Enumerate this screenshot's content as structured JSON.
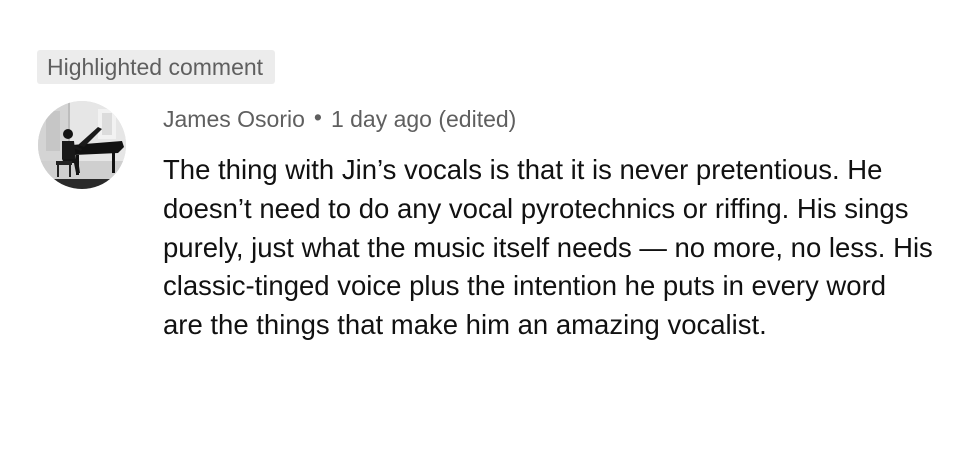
{
  "highlight_label": "Highlighted comment",
  "comment": {
    "author": "James Osorio",
    "separator": "•",
    "timestamp": "1 day ago (edited)",
    "text": "The thing with Jin’s vocals is that it is never pretentious. He doesn’t need to do any vocal pyrotechnics or riffing. His sings purely, just what the music itself needs — no more, no less. His classic-tinged voice plus the intention he puts in every word are the things that make him an amazing vocalist.",
    "avatar_icon": "avatar-pianist-photo"
  },
  "colors": {
    "background": "#ffffff",
    "chip_background": "#ececec",
    "meta_text": "#5f5f5f",
    "body_text": "#111111"
  }
}
